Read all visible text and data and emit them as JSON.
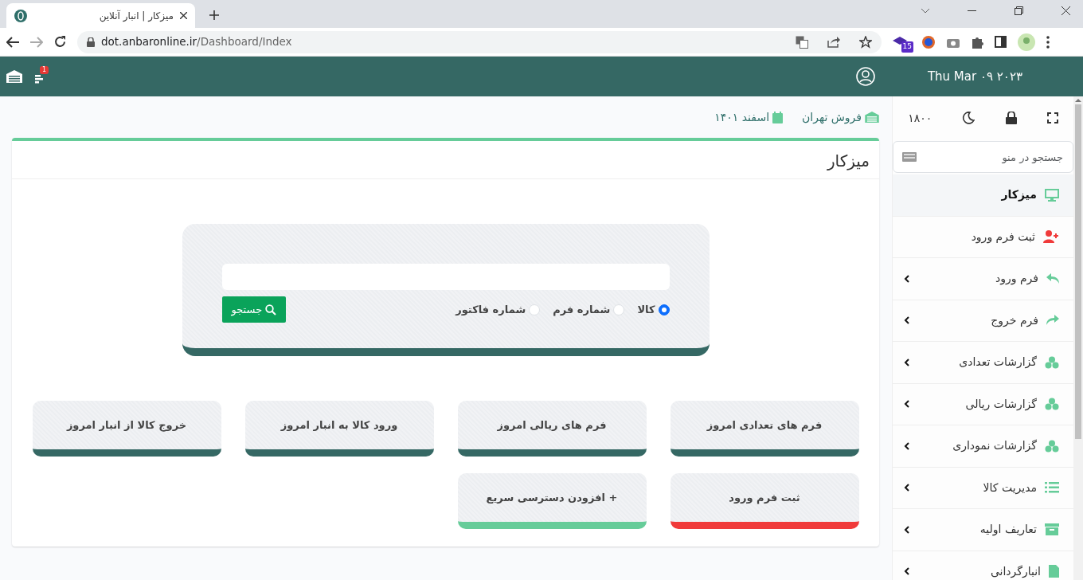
{
  "browser": {
    "tab_title": "میزکار | انبار آنلاین",
    "url_host": "dot.anbaronline.ir",
    "url_path": "/Dashboard/Index",
    "extension_badge": "15"
  },
  "header": {
    "notification_count": "1",
    "date": "Thu Mar ۰۹ ۲۰۲۳"
  },
  "sidebar": {
    "counter": "۱۸۰۰",
    "search": {
      "placeholder": "جستجو در منو"
    },
    "items": [
      {
        "label": "میزکار",
        "selected": true,
        "expandable": false,
        "color": "#66cc99"
      },
      {
        "label": "ثبت فرم ورود",
        "selected": false,
        "expandable": false,
        "color": "#f03a3a"
      },
      {
        "label": "فرم ورود",
        "selected": false,
        "expandable": true,
        "color": "#66cc99"
      },
      {
        "label": "فرم خروج",
        "selected": false,
        "expandable": true,
        "color": "#66cc99"
      },
      {
        "label": "گزارشات تعدادی",
        "selected": false,
        "expandable": true,
        "color": "#66cc99"
      },
      {
        "label": "گزارشات ریالی",
        "selected": false,
        "expandable": true,
        "color": "#66cc99"
      },
      {
        "label": "گزارشات نموداری",
        "selected": false,
        "expandable": true,
        "color": "#66cc99"
      },
      {
        "label": "مدیریت کالا",
        "selected": false,
        "expandable": true,
        "color": "#66cc99"
      },
      {
        "label": "تعاریف اولیه",
        "selected": false,
        "expandable": true,
        "color": "#66cc99"
      },
      {
        "label": "انبارگردانی",
        "selected": false,
        "expandable": true,
        "color": "#66cc99"
      }
    ]
  },
  "breadcrumb": {
    "warehouse": "فروش تهران",
    "period": "اسفند ۱۴۰۱"
  },
  "card": {
    "title": "میزکار"
  },
  "search_panel": {
    "radios": [
      {
        "label": "کالا",
        "selected": true
      },
      {
        "label": "شماره فرم",
        "selected": false
      },
      {
        "label": "شماره فاکتور",
        "selected": false
      }
    ],
    "button": "جستجو"
  },
  "tiles": [
    {
      "label": "فرم های تعدادی امروز",
      "color": "#356864"
    },
    {
      "label": "فرم های ریالی امروز",
      "color": "#356864"
    },
    {
      "label": "ورود کالا به انبار امروز",
      "color": "#356864"
    },
    {
      "label": "خروج کالا از انبار امروز",
      "color": "#356864"
    },
    {
      "label": "ثبت فرم ورود",
      "color": "#f03a3a"
    },
    {
      "label": "+ افزودن دسترسی سریع",
      "color": "#66cc99"
    }
  ]
}
